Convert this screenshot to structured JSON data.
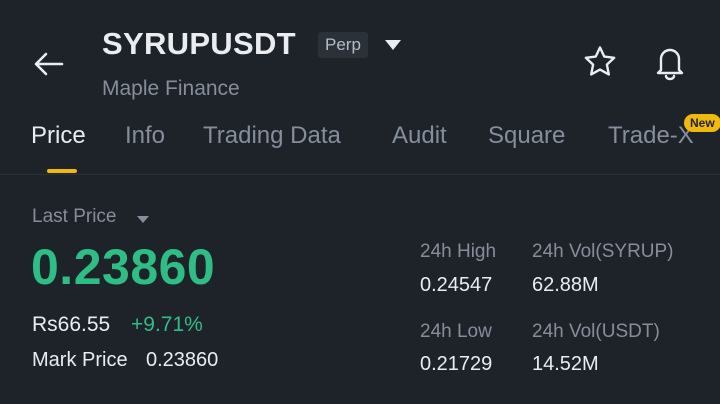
{
  "header": {
    "symbol": "SYRUPUSDT",
    "contract_type": "Perp",
    "subtitle": "Maple Finance",
    "icons": [
      "back-arrow-icon",
      "caret-down-icon",
      "star-icon",
      "bell-icon"
    ]
  },
  "tabs": [
    {
      "label": "Price",
      "active": true
    },
    {
      "label": "Info",
      "active": false
    },
    {
      "label": "Trading Data",
      "active": false
    },
    {
      "label": "Audit",
      "active": false
    },
    {
      "label": "Square",
      "active": false
    },
    {
      "label": "Trade-X",
      "active": false,
      "badge": "New"
    }
  ],
  "price": {
    "last_price_label": "Last Price",
    "last_price": "0.23860",
    "fiat_price": "Rs66.55",
    "change_pct": "+9.71%",
    "mark_price_label": "Mark Price",
    "mark_price": "0.23860"
  },
  "stats": {
    "high_label": "24h High",
    "high_value": "0.24547",
    "vol_base_label": "24h Vol(SYRUP)",
    "vol_base_value": "62.88M",
    "low_label": "24h Low",
    "low_value": "0.21729",
    "vol_quote_label": "24h Vol(USDT)",
    "vol_quote_value": "14.52M"
  },
  "colors": {
    "background": "#1e2329",
    "accent": "#f0b90b",
    "up": "#2ebd85",
    "muted": "#848e9c",
    "text": "#eaecef"
  }
}
